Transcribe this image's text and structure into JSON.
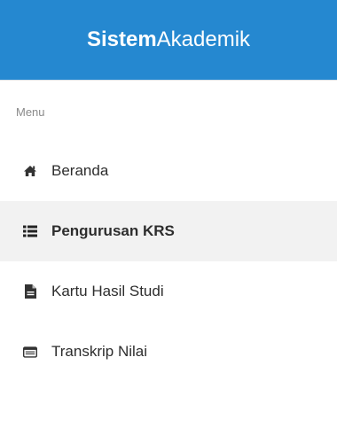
{
  "brand": {
    "bold": "Sistem",
    "light": "Akademik",
    "color": "#2588d0"
  },
  "menu": {
    "header": "Menu",
    "items": [
      {
        "label": "Beranda",
        "icon": "home-icon",
        "active": false
      },
      {
        "label": "Pengurusan KRS",
        "icon": "list-icon",
        "active": true
      },
      {
        "label": "Kartu Hasil Studi",
        "icon": "file-icon",
        "active": false
      },
      {
        "label": "Transkrip Nilai",
        "icon": "table-icon",
        "active": false
      }
    ]
  }
}
